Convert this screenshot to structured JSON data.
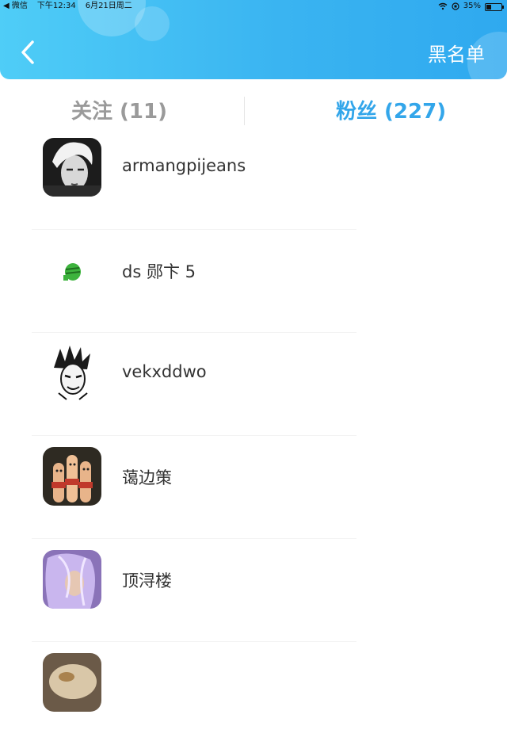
{
  "status_bar": {
    "back_app": "◀ 微信",
    "time": "下午12:34",
    "date": "6月21日周二",
    "battery": "35%",
    "battery_level": 0.35
  },
  "header": {
    "back_icon": "chevron-left-icon",
    "right_label": "黑名单",
    "colors": {
      "gradient_start": "#4fcdf7",
      "gradient_end": "#2fa9ef",
      "accent": "#33a6ea"
    }
  },
  "tabs": [
    {
      "label": "关注 (11)",
      "active": false
    },
    {
      "label": "粉丝 (227)",
      "active": true
    }
  ],
  "fans": [
    {
      "name": "armangpijeans"
    },
    {
      "name": "ds 郧卞 5"
    },
    {
      "name": "vekxddwo"
    },
    {
      "name": "蔼边策"
    },
    {
      "name": "顶浔楼"
    },
    {
      "name": ""
    }
  ]
}
